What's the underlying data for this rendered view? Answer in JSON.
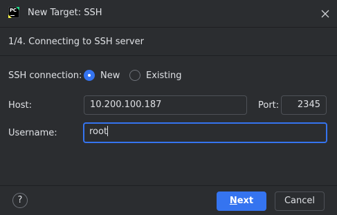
{
  "window": {
    "title": "New Target: SSH",
    "app_icon": "pycharm-logo-icon",
    "close_icon": "close-icon"
  },
  "step": {
    "text": "1/4. Connecting to SSH server"
  },
  "form": {
    "connection_label": "SSH connection:",
    "options": [
      {
        "label": "New",
        "selected": true
      },
      {
        "label": "Existing",
        "selected": false
      }
    ],
    "host_label": "Host:",
    "host_value": "10.200.100.187",
    "port_label": "Port:",
    "port_value": "2345",
    "username_label": "Username:",
    "username_value": "root"
  },
  "footer": {
    "help_label": "?",
    "next_mnemonic": "N",
    "next_rest": "ext",
    "cancel_label": "Cancel"
  },
  "colors": {
    "background": "#2b2d30",
    "accent": "#3574f0",
    "border": "#4e5157",
    "text": "#dfe1e5"
  }
}
